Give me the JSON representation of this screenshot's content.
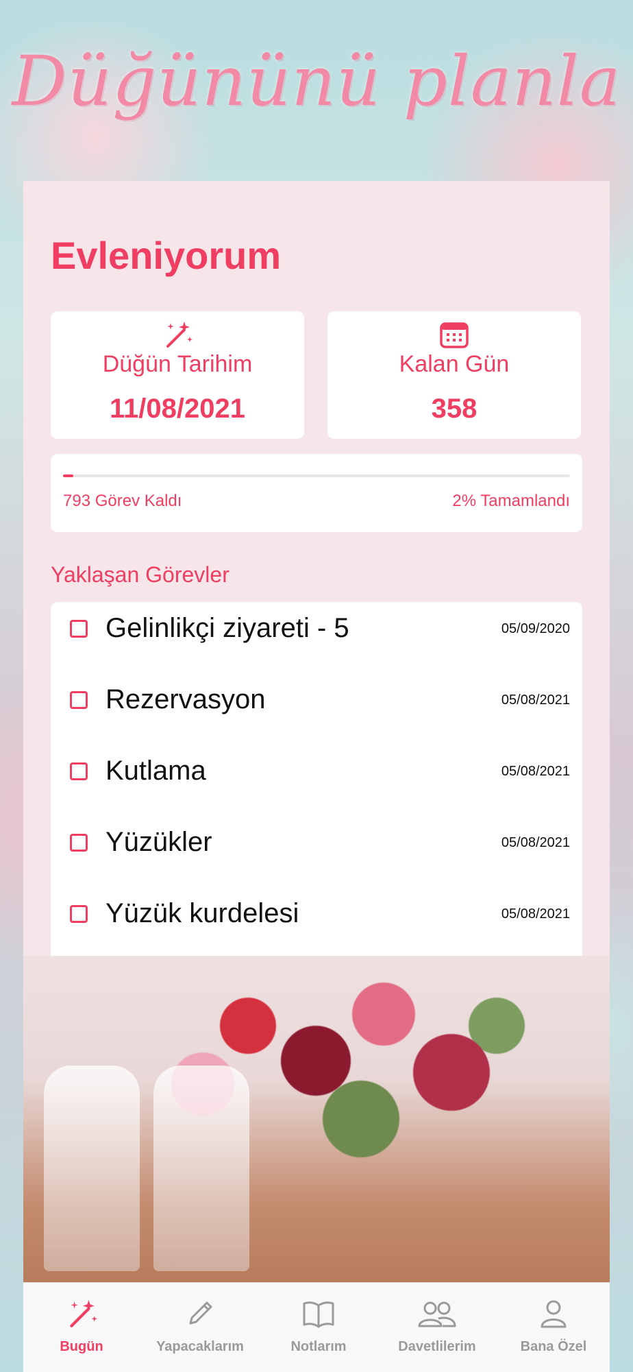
{
  "header": {
    "headline": "Düğününü planla"
  },
  "main": {
    "title": "Evleniyorum",
    "stats": [
      {
        "icon": "magic-wand-icon",
        "label": "Düğün Tarihim",
        "value": "11/08/2021"
      },
      {
        "icon": "calendar-icon",
        "label": "Kalan Gün",
        "value": "358"
      }
    ],
    "progress": {
      "remaining_label": "793 Görev Kaldı",
      "completed_label": "2% Tamamlandı",
      "percent": 2
    },
    "upcoming_label": "Yaklaşan Görevler",
    "tasks": [
      {
        "title": "Gelinlikçi ziyareti - 5",
        "date": "05/09/2020"
      },
      {
        "title": "Rezervasyon",
        "date": "05/08/2021"
      },
      {
        "title": "Kutlama",
        "date": "05/08/2021"
      },
      {
        "title": "Yüzükler",
        "date": "05/08/2021"
      },
      {
        "title": "Yüzük kurdelesi",
        "date": "05/08/2021"
      }
    ]
  },
  "tabbar": {
    "items": [
      {
        "label": "Bugün",
        "icon": "magic-wand-icon",
        "active": true
      },
      {
        "label": "Yapacaklarım",
        "icon": "pencil-icon",
        "active": false
      },
      {
        "label": "Notlarım",
        "icon": "book-icon",
        "active": false
      },
      {
        "label": "Davetlilerim",
        "icon": "people-icon",
        "active": false
      },
      {
        "label": "Bana Özel",
        "icon": "person-icon",
        "active": false
      }
    ]
  },
  "colors": {
    "accent": "#f03e62",
    "inactive": "#9a9a9a",
    "headline": "#f28aa6"
  }
}
